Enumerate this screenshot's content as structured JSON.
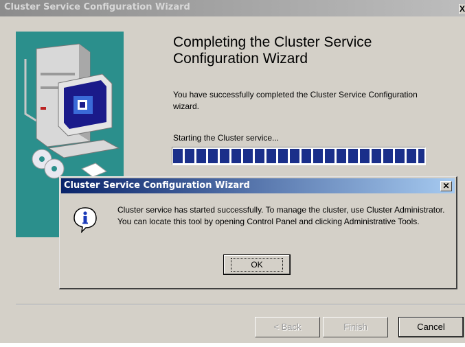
{
  "wizard": {
    "title": "Cluster Service Configuration Wizard",
    "close_glyph": "X",
    "heading": "Completing the Cluster Service Configuration Wizard",
    "message": "You have successfully completed the Cluster Service Configuration wizard.",
    "status_text": "Starting the Cluster service...",
    "progress_fraction": 1.0,
    "buttons": {
      "back": "< Back",
      "finish": "Finish",
      "cancel": "Cancel"
    }
  },
  "dialog": {
    "title": "Cluster Service Configuration Wizard",
    "close_glyph": "✕",
    "icon": "info-icon",
    "message": "Cluster service has started successfully. To manage the cluster, use Cluster Administrator. You can locate this tool by opening Control Panel and clicking Administrative Tools.",
    "ok_label": "OK"
  },
  "colors": {
    "side_panel": "#2b8f8c",
    "progress_block": "#1a2f8a",
    "dialog_title_start": "#0a246a"
  }
}
